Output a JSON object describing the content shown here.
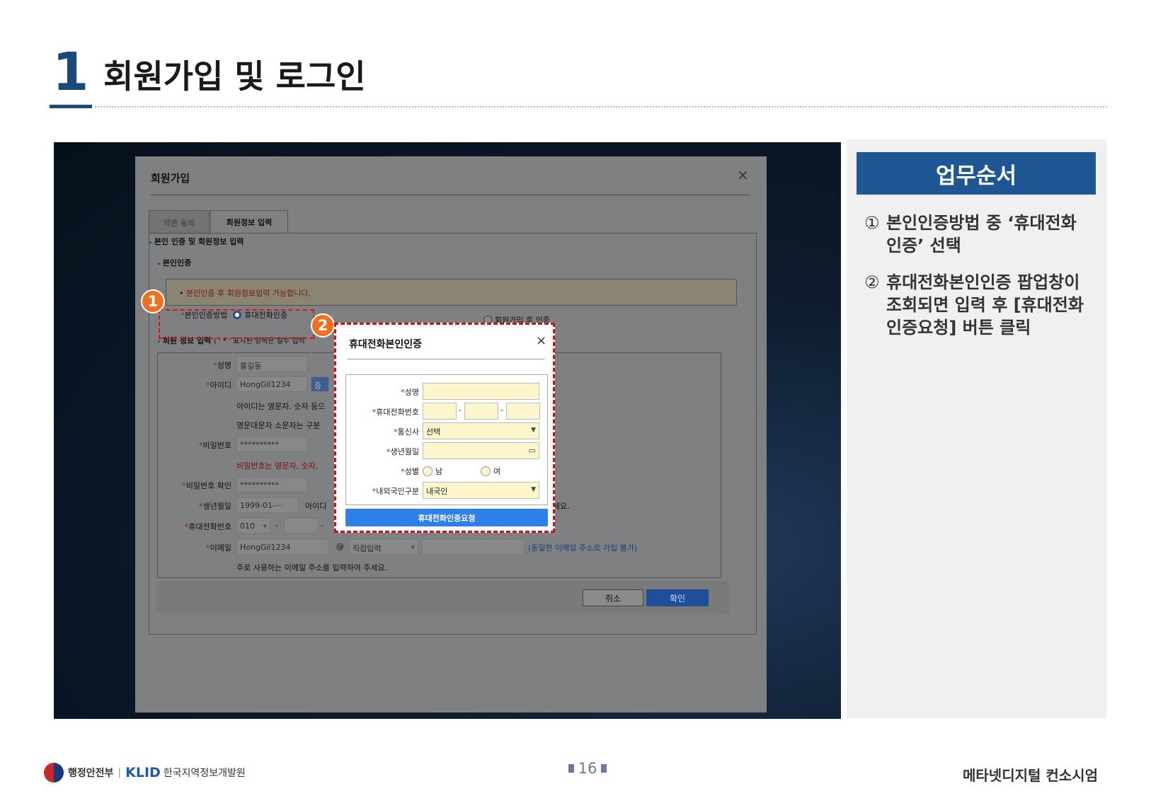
{
  "header": {
    "section_number": "1",
    "section_title": "회원가입 및 로그인"
  },
  "modal": {
    "title": "회원가입",
    "close": "×",
    "tabs": [
      "약관 동의",
      "회원정보 입력"
    ],
    "section_auth_info": "본인 인증 및 회원정보 입력",
    "section_auth": "본인인증",
    "notice": "본인인증 후 회원정보입력 가능합니다.",
    "auth_method_label": "본인인증방법",
    "auth_option_phone": "휴대전화인증",
    "auth_option_after": "회원가입 후 인증",
    "section_member_info": "회원 정보 입력",
    "section_member_info_hint": "( ' * ' 표시된 항목은 필수 입력",
    "fields": {
      "name_label": "성명",
      "name_value": "홍길동",
      "id_label": "아이디",
      "id_value": "HongGil1234",
      "id_button": "중",
      "id_note1": "아이디는 영문자, 숫자 등으",
      "id_note2": "영문대문자 소문자는 구분",
      "pw_label": "비밀번호",
      "pw_value": "**********",
      "pw_note": "비밀번호는 영문자, 숫자,",
      "pw_confirm_label": "비밀번호 확인",
      "pw_confirm_value": "**********",
      "birth_label": "생년월일",
      "birth_value": "1999-01-···",
      "birth_hint": "아이디",
      "birth_hint_tail": "세요.",
      "phone_label": "휴대전화번호",
      "phone_prefix": "010",
      "dash": "-",
      "email_label": "이메일",
      "email_value": "HongGil1234",
      "at": "@",
      "email_domain": "직접입력",
      "email_warning": "(동일한 이메일 주소로 가입 불가)",
      "email_note": "주로 사용하는 이메일 주소를 입력하여 주세요."
    },
    "cancel_button": "취소",
    "ok_button": "확인"
  },
  "popup": {
    "title": "휴대전화본인인증",
    "close": "×",
    "name_label": "성명",
    "phone_label": "휴대전화번호",
    "dash": "-",
    "carrier_label": "통신사",
    "carrier_value": "선택",
    "birth_label": "생년월일",
    "gender_label": "성별",
    "gender_male": "남",
    "gender_female": "여",
    "nationality_label": "내외국인구분",
    "nationality_value": "내국인",
    "submit_button": "휴대전화인증요청"
  },
  "markers": [
    "1",
    "2"
  ],
  "sidebar": {
    "title": "업무순서",
    "steps": [
      {
        "num": "①",
        "line1": "본인인증방법 중 ‘휴대전화",
        "line2": "인증’ 선택"
      },
      {
        "num": "②",
        "line1": "휴대전화본인인증 팝업창이",
        "line2": "조회되면 입력 후 [휴대전화",
        "line3": "인증요청] 버튼 클릭"
      }
    ]
  },
  "footer": {
    "gov_name": "행정안전부",
    "separator": "|",
    "klid_logo": "KLID",
    "klid_name": "한국지역정보개발원",
    "page_number": "16",
    "right_text": "메타넷디지털 컨소시엄"
  },
  "colors": {
    "accent": "#1f5795",
    "marker": "#f07020",
    "highlight": "#d01a1a",
    "popup_button": "#2f7fe8"
  }
}
